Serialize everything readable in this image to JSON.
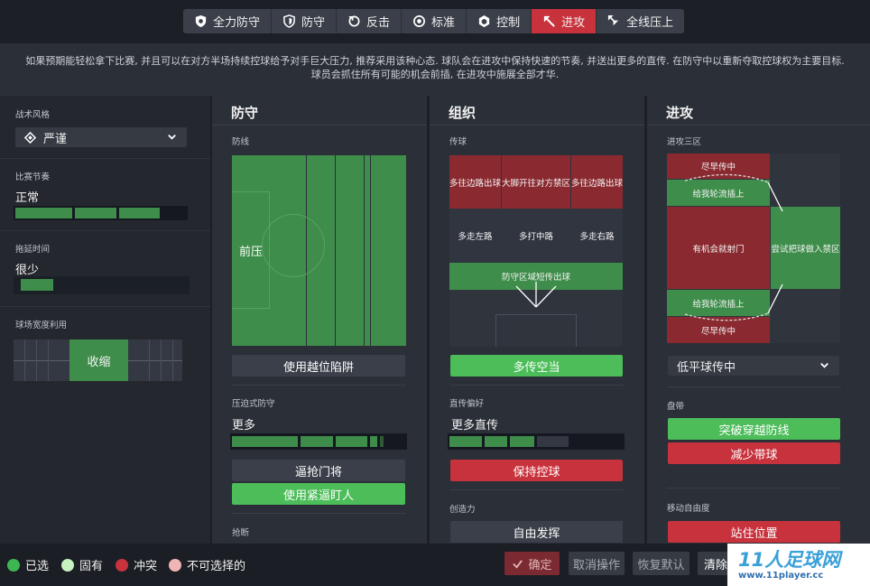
{
  "mentality": {
    "buttons": [
      {
        "label": "全力防守",
        "icon": "shield-full-icon"
      },
      {
        "label": "防守",
        "icon": "shield-icon"
      },
      {
        "label": "反击",
        "icon": "counter-icon"
      },
      {
        "label": "标准",
        "icon": "balanced-icon"
      },
      {
        "label": "控制",
        "icon": "control-icon"
      },
      {
        "label": "进攻",
        "icon": "attack-icon",
        "active": true
      },
      {
        "label": "全线压上",
        "icon": "very-attacking-icon"
      }
    ],
    "description_line1": "如果预期能轻松拿下比赛, 并且可以在对方半场持续控球给予对手巨大压力, 推荐采用该种心态. 球队会在进攻中保持快速的节奏, 并送出更多的直传. 在防守中以重新夺取控球权为主要目标.",
    "description_line2": "球员会抓住所有可能的机会前插, 在进攻中施展全部才华."
  },
  "left": {
    "style_label": "战术风格",
    "style_value": "严谨",
    "tempo_label": "比赛节奏",
    "tempo_value": "正常",
    "tempo_level": 3,
    "timewasting_label": "拖延时间",
    "timewasting_value": "很少",
    "timewasting_level": 1,
    "width_label": "球场宽度利用",
    "width_value": "收缩"
  },
  "defense": {
    "title": "防守",
    "line_label": "防线",
    "line_value": "前压",
    "offside_button": "使用越位陷阱",
    "press_label": "压迫式防守",
    "press_value": "更多",
    "press_level": 4,
    "btn_force": "逼抢门将",
    "btn_tight": "使用紧逼盯人",
    "tackle_label": "抢断"
  },
  "organization": {
    "title": "组织",
    "passing_label": "传球",
    "zones": {
      "a1": "多往边路出球",
      "a2": "大脚开往对方禁区",
      "a3": "多往边路出球",
      "b1": "多走左路",
      "b2": "多打中路",
      "b3": "多走右路",
      "c": "防守区域短传出球"
    },
    "overlap_button": "多传空当",
    "direct_label": "直传偏好",
    "direct_value": "更多直传",
    "direct_level": 3,
    "keep_button": "保持控球",
    "creative_label": "创造力",
    "creative_button": "自由发挥"
  },
  "attack": {
    "title": "进攻",
    "third_label": "进攻三区",
    "zones": {
      "early1": "尽早传中",
      "wide1": "给我轮流插上",
      "shoot": "有机会就射门",
      "box": "尝试把球做入禁区",
      "wide2": "给我轮流插上",
      "early2": "尽早传中"
    },
    "cross_value": "低平球传中",
    "dribble_label": "盘带",
    "dribble_btn1": "突破穿越防线",
    "dribble_btn2": "减少带球",
    "roaming_label": "移动自由度",
    "roaming_btn": "站住位置"
  },
  "footer": {
    "legend": [
      {
        "label": "已选",
        "color": "#3db651"
      },
      {
        "label": "固有",
        "color": "#c6f1c0"
      },
      {
        "label": "冲突",
        "color": "#c8323c"
      },
      {
        "label": "不可选择的",
        "color": "#f0b5b5"
      }
    ],
    "confirm": "确定",
    "cancel": "取消操作",
    "reset": "恢复默认",
    "clear": "清除"
  },
  "watermark": {
    "title": "11人足球网",
    "url": "www.11player.cc"
  }
}
